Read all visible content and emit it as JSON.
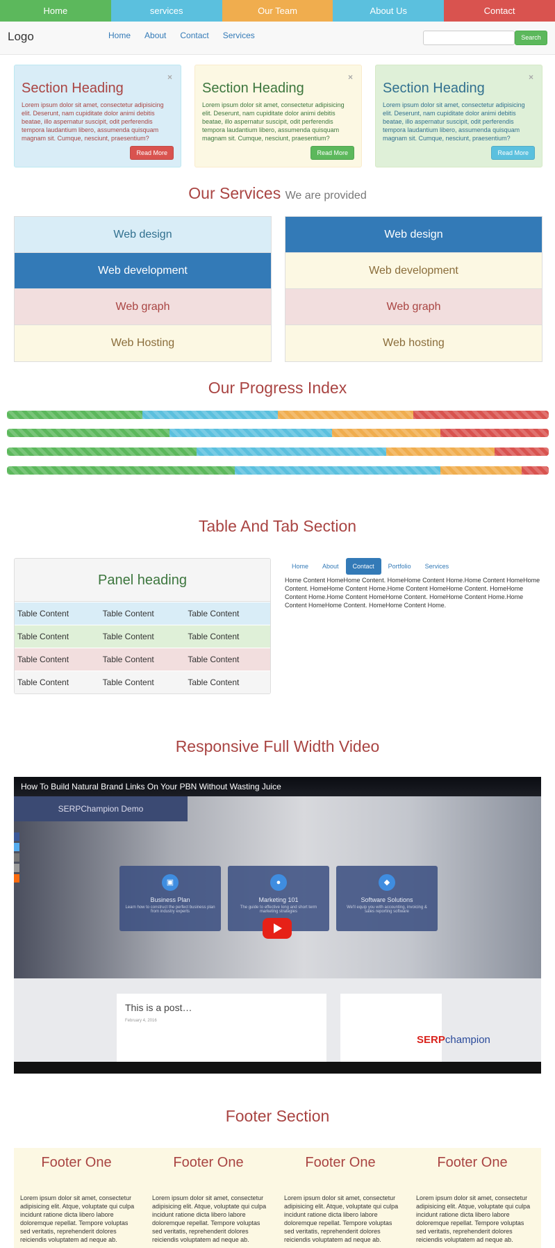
{
  "top_nav": [
    {
      "label": "Home",
      "color": "#5cb85c"
    },
    {
      "label": "services",
      "color": "#5bc0de"
    },
    {
      "label": "Our Team",
      "color": "#f0ad4e"
    },
    {
      "label": "About Us",
      "color": "#5bc0de"
    },
    {
      "label": "Contact",
      "color": "#d9534f"
    }
  ],
  "navbar": {
    "logo": "Logo",
    "links": [
      "Home",
      "About",
      "Contact",
      "Services"
    ],
    "search_placeholder": "",
    "search_button": "Search"
  },
  "alerts": [
    {
      "heading": "Section Heading",
      "text": "Lorem ipsum dolor sit amet, consectetur adipisicing elit. Deserunt, nam cupiditate dolor animi debitis beatae, illo aspernatur suscipit, odit perferendis tempora laudantium libero, assumenda quisquam magnam sit. Cumque, nesciunt, praesentium?",
      "button": "Read More",
      "close": "×",
      "bg": "#d9edf7",
      "border": "#bce8f1",
      "heading_color": "#a94442",
      "text_color": "#a94442",
      "button_color": "#d9534f"
    },
    {
      "heading": "Section Heading",
      "text": "Lorem ipsum dolor sit amet, consectetur adipisicing elit. Deserunt, nam cupiditate dolor animi debitis beatae, illo aspernatur suscipit, odit perferendis tempora laudantium libero, assumenda quisquam magnam sit. Cumque, nesciunt, praesentium?",
      "button": "Read More",
      "close": "×",
      "bg": "#fcf8e3",
      "border": "#faebcc",
      "heading_color": "#3c763d",
      "text_color": "#3c763d",
      "button_color": "#5cb85c"
    },
    {
      "heading": "Section Heading",
      "text": "Lorem ipsum dolor sit amet, consectetur adipisicing elit. Deserunt, nam cupiditate dolor animi debitis beatae, illo aspernatur suscipit, odit perferendis tempora laudantium libero, assumenda quisquam magnam sit. Cumque, nesciunt, praesentium?",
      "button": "Read More",
      "close": "×",
      "bg": "#dff0d8",
      "border": "#d6e9c6",
      "heading_color": "#31708f",
      "text_color": "#31708f",
      "button_color": "#5bc0de"
    }
  ],
  "services": {
    "title": "Our Services",
    "subtitle": "We are provided",
    "left": [
      {
        "label": "Web design",
        "bg": "#d9edf7",
        "color": "#31708f"
      },
      {
        "label": "Web development",
        "bg": "#337ab7",
        "color": "#ffffff"
      },
      {
        "label": "Web graph",
        "bg": "#f2dede",
        "color": "#a94442"
      },
      {
        "label": "Web Hosting",
        "bg": "#fcf8e3",
        "color": "#8a6d3b"
      }
    ],
    "right": [
      {
        "label": "Web design",
        "bg": "#337ab7",
        "color": "#ffffff"
      },
      {
        "label": "Web development",
        "bg": "#fcf8e3",
        "color": "#8a6d3b"
      },
      {
        "label": "Web graph",
        "bg": "#f2dede",
        "color": "#a94442"
      },
      {
        "label": "Web hosting",
        "bg": "#fcf8e3",
        "color": "#8a6d3b"
      }
    ]
  },
  "progress": {
    "title": "Our Progress Index",
    "colors": [
      "#5cb85c",
      "#5bc0de",
      "#f0ad4e",
      "#d9534f"
    ],
    "bars": [
      [
        25,
        25,
        25,
        25
      ],
      [
        30,
        30,
        20,
        20
      ],
      [
        35,
        35,
        20,
        10
      ],
      [
        42,
        38,
        15,
        5
      ]
    ]
  },
  "table_tab": {
    "title": "Table And Tab Section",
    "panel_heading": "Panel heading",
    "rows": [
      {
        "cells": [
          "Table Content",
          "Table Content",
          "Table Content"
        ],
        "bg": "#d9edf7"
      },
      {
        "cells": [
          "Table Content",
          "Table Content",
          "Table Content"
        ],
        "bg": "#dff0d8"
      },
      {
        "cells": [
          "Table Content",
          "Table Content",
          "Table Content"
        ],
        "bg": "#f2dede"
      },
      {
        "cells": [
          "Table Content",
          "Table Content",
          "Table Content"
        ],
        "bg": "#f5f5f5"
      }
    ],
    "tabs": [
      "Home",
      "About",
      "Contact",
      "Portfolio",
      "Services"
    ],
    "active_tab": "Contact",
    "tab_content": "Home Content HomeHome Content. HomeHome Content Home.Home Content HomeHome Content. HomeHome Content Home.Home Content HomeHome Content. HomeHome Content Home.Home Content HomeHome Content. HomeHome Content Home.Home Content HomeHome Content. HomeHome Content Home."
  },
  "video": {
    "title": "Responsive Full Width Video",
    "video_title": "How To Build Natural Brand Links On Your PBN Without Wasting Juice",
    "demo_label": "SERPChampion Demo",
    "cards": [
      {
        "title": "Business Plan",
        "desc": "Learn how to construct the perfect business plan from industry experts",
        "icon": "briefcase-icon"
      },
      {
        "title": "Marketing 101",
        "desc": "The guide to effective long and short term marketing strategies",
        "icon": "people-icon"
      },
      {
        "title": "Software Solutions",
        "desc": "We'll equip you with accounting, invoicing & sales reporting software",
        "icon": "cart-icon"
      }
    ],
    "post_title": "This is a post…",
    "post_date": "February 4, 2016",
    "brand_a": "SERP",
    "brand_b": "champion"
  },
  "footer": {
    "title": "Footer Section",
    "columns": [
      {
        "heading": "Footer One",
        "text": "Lorem ipsum dolor sit amet, consectetur adipisicing elit. Atque, voluptate qui culpa incidunt ratione dicta libero labore doloremque repellat. Tempore voluptas sed veritatis, reprehenderit dolores reiciendis voluptatem ad neque ab."
      },
      {
        "heading": "Footer One",
        "text": "Lorem ipsum dolor sit amet, consectetur adipisicing elit. Atque, voluptate qui culpa incidunt ratione dicta libero labore doloremque repellat. Tempore voluptas sed veritatis, reprehenderit dolores reiciendis voluptatem ad neque ab."
      },
      {
        "heading": "Footer One",
        "text": "Lorem ipsum dolor sit amet, consectetur adipisicing elit. Atque, voluptate qui culpa incidunt ratione dicta libero labore doloremque repellat. Tempore voluptas sed veritatis, reprehenderit dolores reiciendis voluptatem ad neque ab."
      },
      {
        "heading": "Footer One",
        "text": "Lorem ipsum dolor sit amet, consectetur adipisicing elit. Atque, voluptate qui culpa incidunt ratione dicta libero labore doloremque repellat. Tempore voluptas sed veritatis, reprehenderit dolores reiciendis voluptatem ad neque ab."
      }
    ]
  }
}
